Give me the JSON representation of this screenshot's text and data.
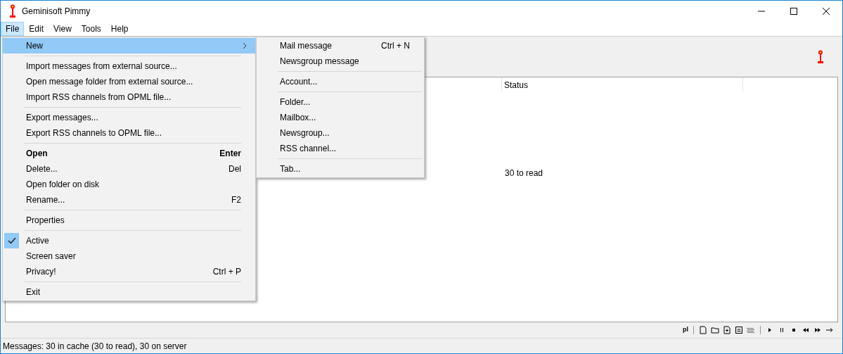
{
  "window": {
    "title": "Geminisoft Pimmy"
  },
  "menu_bar": [
    {
      "label": "File",
      "selected": true
    },
    {
      "label": "Edit",
      "selected": false
    },
    {
      "label": "View",
      "selected": false
    },
    {
      "label": "Tools",
      "selected": false
    },
    {
      "label": "Help",
      "selected": false
    }
  ],
  "list": {
    "columns": [
      {
        "label": "Status"
      }
    ],
    "rows": [
      {
        "status": "30 to read"
      }
    ]
  },
  "file_menu": [
    {
      "kind": "item",
      "label": "New",
      "submenu": true,
      "selected": true,
      "bold": false,
      "checked": false
    },
    {
      "kind": "separator"
    },
    {
      "kind": "item",
      "label": "Import messages from external source...",
      "submenu": false,
      "selected": false,
      "bold": false,
      "checked": false
    },
    {
      "kind": "item",
      "label": "Open message folder from external source...",
      "submenu": false,
      "selected": false,
      "bold": false,
      "checked": false
    },
    {
      "kind": "item",
      "label": "Import RSS channels from OPML file...",
      "submenu": false,
      "selected": false,
      "bold": false,
      "checked": false
    },
    {
      "kind": "separator"
    },
    {
      "kind": "item",
      "label": "Export messages...",
      "submenu": false,
      "selected": false,
      "bold": false,
      "checked": false
    },
    {
      "kind": "item",
      "label": "Export RSS channels to OPML file...",
      "submenu": false,
      "selected": false,
      "bold": false,
      "checked": false
    },
    {
      "kind": "separator"
    },
    {
      "kind": "item",
      "label": "Open",
      "shortcut": "Enter",
      "submenu": false,
      "selected": false,
      "bold": true,
      "checked": false
    },
    {
      "kind": "item",
      "label": "Delete...",
      "shortcut": "Del",
      "submenu": false,
      "selected": false,
      "bold": false,
      "checked": false
    },
    {
      "kind": "item",
      "label": "Open folder on disk",
      "submenu": false,
      "selected": false,
      "bold": false,
      "checked": false
    },
    {
      "kind": "item",
      "label": "Rename...",
      "shortcut": "F2",
      "submenu": false,
      "selected": false,
      "bold": false,
      "checked": false
    },
    {
      "kind": "separator"
    },
    {
      "kind": "item",
      "label": "Properties",
      "submenu": false,
      "selected": false,
      "bold": false,
      "checked": false
    },
    {
      "kind": "separator"
    },
    {
      "kind": "item",
      "label": "Active",
      "submenu": false,
      "selected": false,
      "bold": false,
      "checked": true
    },
    {
      "kind": "item",
      "label": "Screen saver",
      "submenu": false,
      "selected": false,
      "bold": false,
      "checked": false
    },
    {
      "kind": "item",
      "label": "Privacy!",
      "shortcut": "Ctrl + P",
      "submenu": false,
      "selected": false,
      "bold": false,
      "checked": false
    },
    {
      "kind": "separator"
    },
    {
      "kind": "item",
      "label": "Exit",
      "submenu": false,
      "selected": false,
      "bold": false,
      "checked": false
    }
  ],
  "new_submenu": [
    {
      "kind": "item",
      "label": "Mail message",
      "shortcut": "Ctrl + N"
    },
    {
      "kind": "item",
      "label": "Newsgroup message"
    },
    {
      "kind": "separator"
    },
    {
      "kind": "item",
      "label": "Account..."
    },
    {
      "kind": "separator"
    },
    {
      "kind": "item",
      "label": "Folder..."
    },
    {
      "kind": "item",
      "label": "Mailbox..."
    },
    {
      "kind": "item",
      "label": "Newsgroup..."
    },
    {
      "kind": "item",
      "label": "RSS channel..."
    },
    {
      "kind": "separator"
    },
    {
      "kind": "item",
      "label": "Tab..."
    }
  ],
  "bottom_toolbar": {
    "label": "pl"
  },
  "status_bar": "Messages: 30 in cache (30 to read), 30 on server"
}
